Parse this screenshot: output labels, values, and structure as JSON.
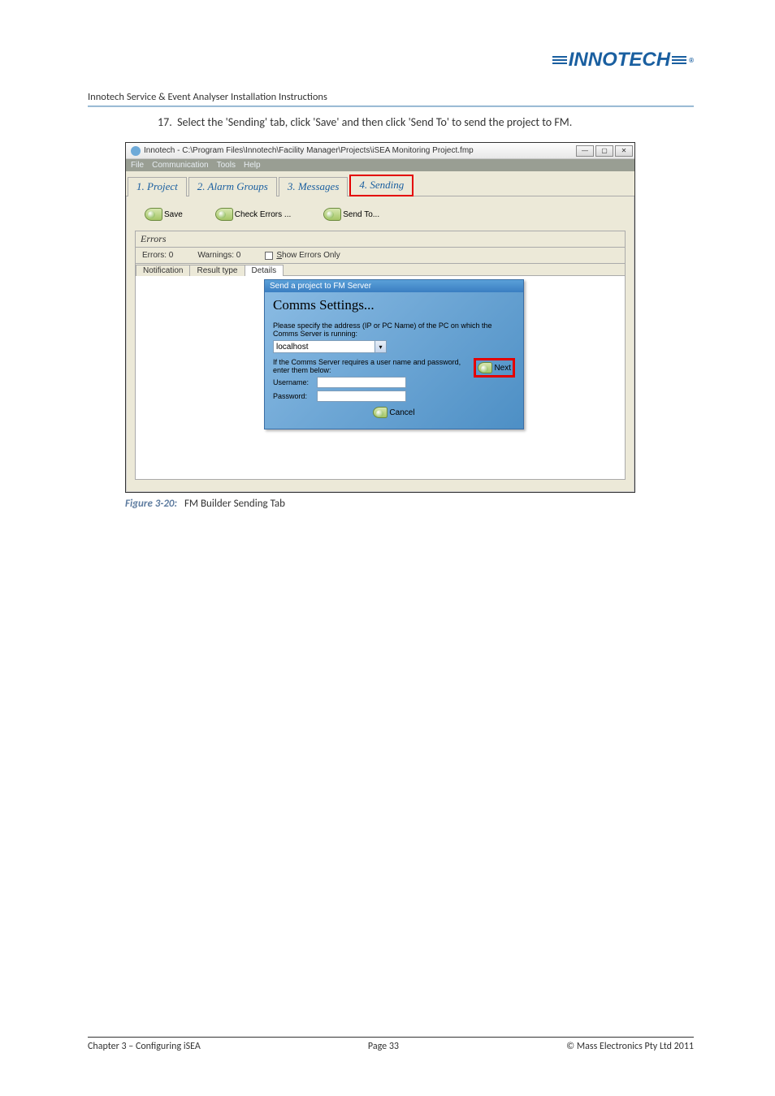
{
  "header": {
    "logo_text": "INNOTECH",
    "doc_title": "Innotech Service & Event Analyser Installation Instructions"
  },
  "step": {
    "number": "17.",
    "text": "Select the 'Sending' tab, click 'Save' and then click 'Send To' to send the project to FM."
  },
  "window": {
    "title": "Innotech  - C:\\Program Files\\Innotech\\Facility Manager\\Projects\\iSEA Monitoring Project.fmp",
    "menus": [
      "File",
      "Communication",
      "Tools",
      "Help"
    ],
    "tabs": [
      "1. Project",
      "2. Alarm Groups",
      "3. Messages",
      "4. Sending"
    ],
    "actions": {
      "save": "Save",
      "check": "Check Errors ...",
      "sendto": "Send To..."
    },
    "errors_panel": {
      "title": "Errors",
      "errors_label": "Errors:",
      "errors_count": "0",
      "warnings_label": "Warnings:",
      "warnings_count": "0",
      "show_only": "Show Errors Only",
      "sub_tabs": [
        "Notification",
        "Result type",
        "Details"
      ]
    }
  },
  "wizard": {
    "title": "Send a project to FM Server",
    "heading": "Comms Settings...",
    "desc1": "Please specify the address (IP or PC Name) of the PC on which the Comms Server is running:",
    "combo_value": "localhost",
    "desc2": "If the Comms Server requires a user name and password, enter them below:",
    "next": "Next",
    "username_label": "Username:",
    "password_label": "Password:",
    "cancel": "Cancel"
  },
  "figure": {
    "label": "Figure 3-20:",
    "caption": "FM Builder Sending Tab"
  },
  "footer": {
    "left": "Chapter 3 – Configuring iSEA",
    "center": "Page 33",
    "right": "©  Mass Electronics Pty Ltd  2011"
  }
}
